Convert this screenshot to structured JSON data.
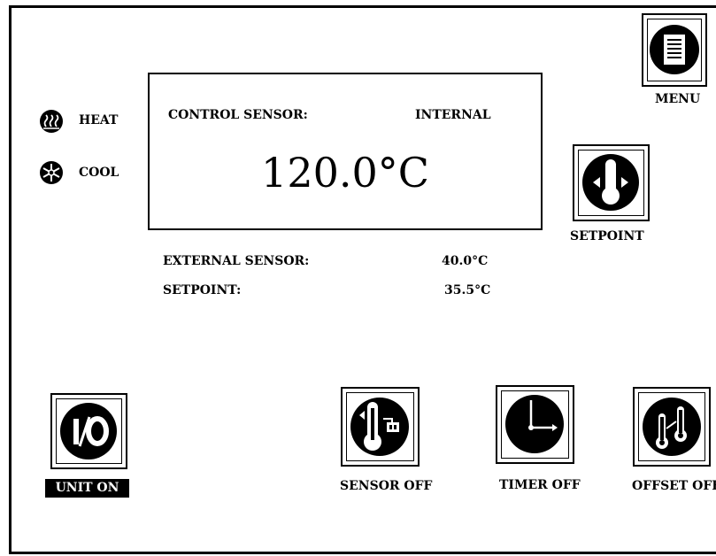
{
  "indicators": {
    "heat_label": "HEAT",
    "cool_label": "COOL"
  },
  "display": {
    "control_sensor_label": "CONTROL SENSOR:",
    "control_sensor_value": "INTERNAL",
    "temperature": "120.0°C"
  },
  "readings": {
    "external_sensor_label": "EXTERNAL SENSOR:",
    "external_sensor_value": "40.0°C",
    "setpoint_label": "SETPOINT:",
    "setpoint_value": "35.5°C"
  },
  "buttons": {
    "menu_label": "MENU",
    "setpoint_label": "SETPOINT",
    "unit_label": "UNIT ON",
    "sensor_label": "SENSOR OFF",
    "timer_label": "TIMER OFF",
    "offset_label": "OFFSET OFF"
  }
}
